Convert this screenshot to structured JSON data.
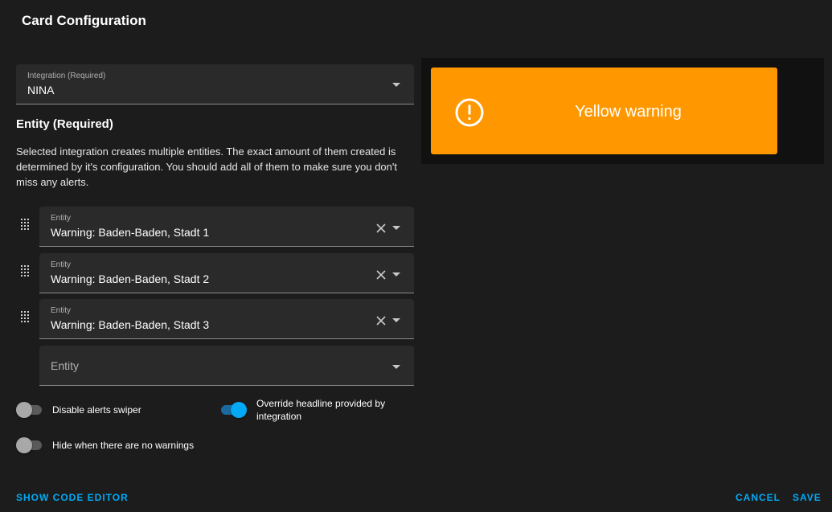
{
  "dialog": {
    "title": "Card Configuration"
  },
  "integration": {
    "label": "Integration (Required)",
    "value": "NINA"
  },
  "entity_section": {
    "title": "Entity (Required)",
    "description": "Selected integration creates multiple entities. The exact amount of them created is determined by it's configuration. You should add all of them to make sure you don't miss any alerts."
  },
  "entities": [
    {
      "label": "Entity",
      "value": "Warning: Baden-Baden, Stadt 1"
    },
    {
      "label": "Entity",
      "value": "Warning: Baden-Baden, Stadt 2"
    },
    {
      "label": "Entity",
      "value": "Warning: Baden-Baden, Stadt 3"
    }
  ],
  "new_entity": {
    "placeholder": "Entity"
  },
  "toggles": {
    "disable_swiper": {
      "label": "Disable alerts swiper",
      "checked": false
    },
    "override_headline": {
      "label": "Override headline provided by integration",
      "checked": true
    },
    "hide_no_warnings": {
      "label": "Hide when there are no warnings",
      "checked": false
    }
  },
  "preview": {
    "alert_text": "Yellow warning",
    "alert_color": "#ff9800",
    "icon": "alert-circle-outline-icon"
  },
  "footer": {
    "code_editor": "Show code editor",
    "cancel": "Cancel",
    "save": "Save"
  },
  "colors": {
    "accent": "#03a9f4",
    "background": "#1c1c1c",
    "field": "#2a2a2a"
  }
}
